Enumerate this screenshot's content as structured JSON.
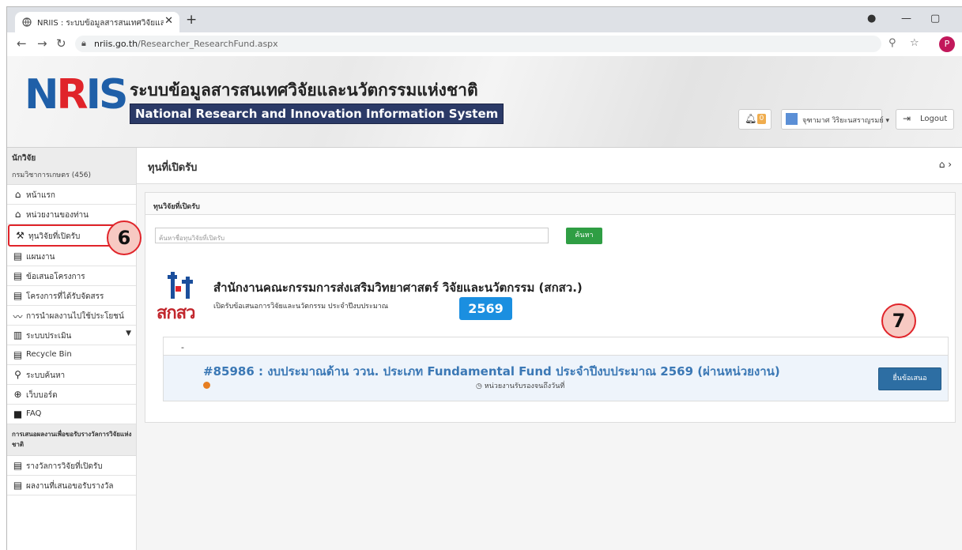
{
  "browser": {
    "tab_title": "NRIIS : ระบบข้อมูลสารสนเทศวิจัยและนวั",
    "tab_close": "✕",
    "new_tab": "+",
    "url_host": "nriis.go.th",
    "url_path": "/Researcher_ResearchFund.aspx",
    "profile_initial": "P"
  },
  "header": {
    "logo_letters": "NRIS",
    "logo_subtext": "NATIONAL RESEARCH AND INNOVATION INFORMATION SYSTEM",
    "thai_title": "ระบบข้อมูลสารสนเทศวิจัยและนวัตกรรมแห่งชาติ",
    "eng_title": "National Research and Innovation Information System",
    "notification_count": "0",
    "user_name": "จุฑามาศ วิริยะนสราญรมย์ ▾",
    "logout_label": "Logout"
  },
  "sidebar": {
    "role": "นักวิจัย",
    "org": "กรมวิชาการเกษตร (456)",
    "items": [
      {
        "label": "หน้าแรก",
        "icon": "home-icon"
      },
      {
        "label": "หน่วยงานของท่าน",
        "icon": "home-icon"
      },
      {
        "label": "ทุนวิจัยที่เปิดรับ",
        "icon": "gavel-icon"
      },
      {
        "label": "แผนงาน",
        "icon": "clipboard-icon"
      },
      {
        "label": "ข้อเสนอโครงการ",
        "icon": "clipboard-icon"
      },
      {
        "label": "โครงการที่ได้รับจัดสรร",
        "icon": "clipboard-icon"
      },
      {
        "label": "การนำผลงานไปใช้ประโยชน์",
        "icon": "chart-line-icon"
      },
      {
        "label": "ระบบประเมิน",
        "icon": "bar-chart-icon"
      },
      {
        "label": "Recycle Bin",
        "icon": "clipboard-icon"
      },
      {
        "label": "ระบบค้นหา",
        "icon": "search-icon"
      },
      {
        "label": "เว็บบอร์ด",
        "icon": "globe-icon"
      },
      {
        "label": "FAQ",
        "icon": "comment-icon"
      }
    ],
    "section_title": "การเสนอผลงานเพื่อขอรับรางวัลการวิจัยแห่งชาติ",
    "award_items": [
      {
        "label": "รางวัลการวิจัยที่เปิดรับ",
        "icon": "list-icon"
      },
      {
        "label": "ผลงานที่เสนอขอรับรางวัล",
        "icon": "list-icon"
      }
    ]
  },
  "main": {
    "page_title": "ทุนที่เปิดรับ",
    "panel_title": "ทุนวิจัยที่เปิดรับ",
    "search_placeholder": "ค้นหาชื่อทุนวิจัยที่เปิดรับ",
    "search_button": "ค้นหา",
    "org_name": "สำนักงานคณะกรรมการส่งเสริมวิทยาศาสตร์ วิจัยและนวัตกรรม (สกสว.)",
    "org_abbr": "สกสว",
    "org_desc": "เปิดรับข้อเสนอการวิจัยและนวัตกรรม ประจำปีงบประมาณ",
    "year": "2569",
    "group_label": "-",
    "fund_title": "#85986 : งบประมาณด้าน ววน. ประเภท Fundamental Fund ประจำปีงบประมาณ 2569 (ผ่านหน่วยงาน)",
    "deadline_label": "หน่วยงานรับรองจนถึงวันที่",
    "submit_button": "ยื่นข้อเสนอ"
  },
  "callouts": {
    "step_a": "6",
    "step_b": "7"
  },
  "colors": {
    "accent_green": "#2f9e44",
    "accent_blue": "#1b8fe0",
    "callout_red": "#e0242a"
  }
}
